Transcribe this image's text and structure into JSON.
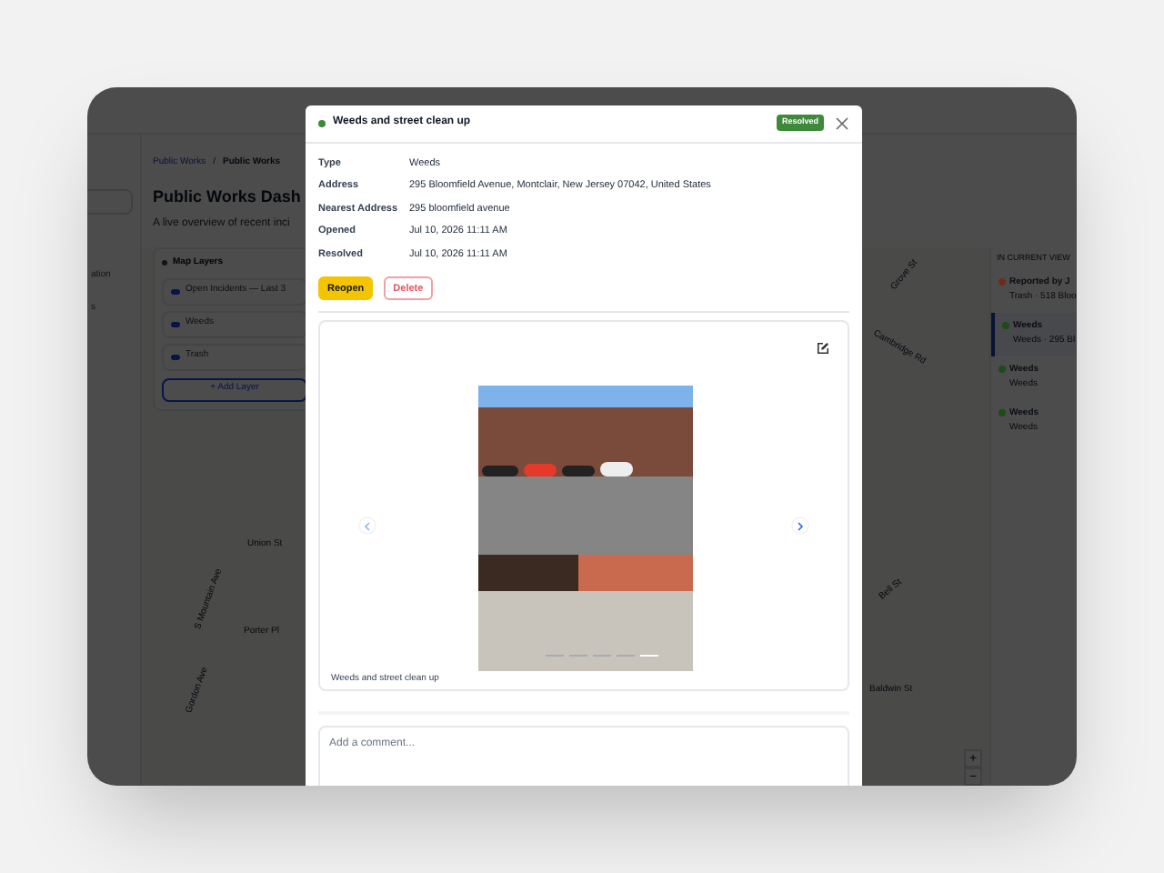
{
  "app": {
    "sidebar_items": [
      "ation",
      "s"
    ],
    "breadcrumb": [
      "Public Works",
      "/",
      "Public Works"
    ],
    "title": "Public Works Dash",
    "subtitle": "A live overview of recent inci",
    "map_layers": {
      "title": "Map Layers",
      "layers": [
        {
          "label": "Open Incidents — Last 3"
        },
        {
          "label": "Weeds"
        },
        {
          "label": "Trash"
        }
      ],
      "add_button": "+ Add Layer"
    },
    "streets": [
      "S Mountain Ave",
      "Union St",
      "Porter Pl",
      "Gordon Ave",
      "Grove St",
      "Cambridge Rd",
      "Bell St",
      "Baldwin St"
    ],
    "zoom_buttons": [
      "+",
      "−"
    ],
    "list": {
      "heading": "IN CURRENT VIEW",
      "items": [
        {
          "title": "Reported by J",
          "subtitle": "Trash · 518 Bloo",
          "color": "#6e2d16",
          "selected": false
        },
        {
          "title": "Weeds",
          "subtitle": "Weeds · 295 Bl",
          "color": "#1f4a1c",
          "selected": true
        },
        {
          "title": "Weeds",
          "subtitle": "Weeds",
          "color": "#1f4a1c",
          "selected": false
        },
        {
          "title": "Weeds",
          "subtitle": "Weeds",
          "color": "#1f4a1c",
          "selected": false
        }
      ]
    }
  },
  "modal": {
    "title": "Weeds and street clean up",
    "badge": "Resolved",
    "fields": [
      {
        "label": "Type",
        "value": "Weeds"
      },
      {
        "label": "Address",
        "value": "295 Bloomfield Avenue, Montclair, New Jersey 07042, United States"
      },
      {
        "label": "Nearest Address",
        "value": "295 bloomfield avenue"
      },
      {
        "label": "Opened",
        "value": "Jul 10, 2026 11:11 AM"
      },
      {
        "label": "Resolved",
        "value": "Jul 10, 2026 11:11 AM"
      }
    ],
    "buttons": [
      {
        "kind": "primary",
        "label": "Reopen"
      },
      {
        "kind": "danger",
        "label": "Delete"
      }
    ],
    "photo": {
      "caption": "Weeds and street clean up",
      "slides": [
        {
          "selected": false
        },
        {
          "selected": false
        },
        {
          "selected": false
        },
        {
          "selected": false
        },
        {
          "selected": true
        }
      ]
    },
    "comment": {
      "placeholder": "Add a comment..."
    }
  }
}
